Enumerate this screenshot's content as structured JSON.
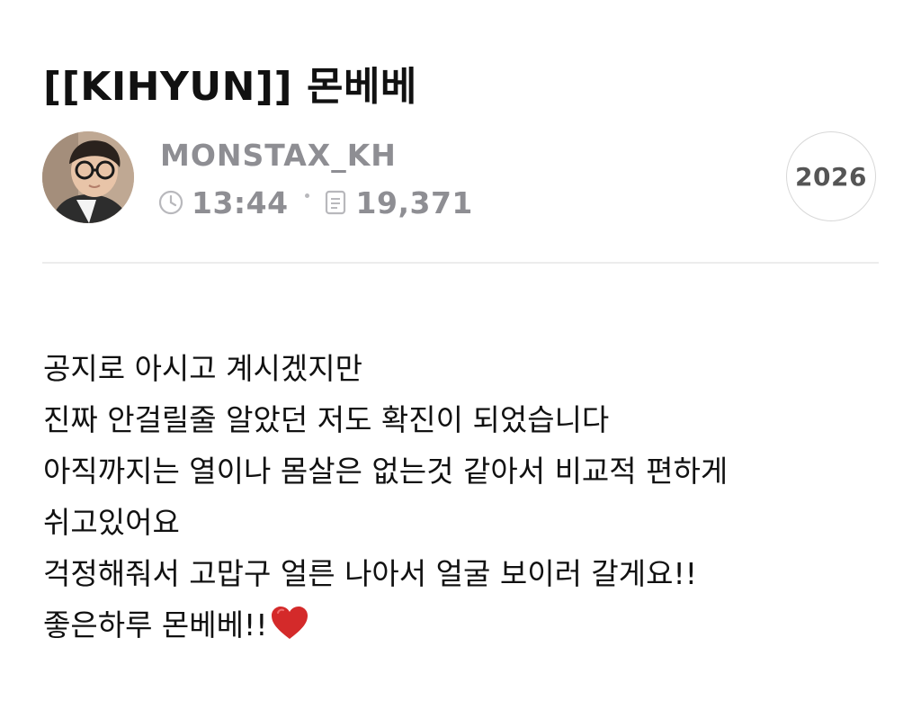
{
  "post": {
    "title": "[[KIHYUN]] 몬베베",
    "author": "MONSTAX_KH",
    "time": "13:44",
    "views": "19,371",
    "count": "2026",
    "lines": [
      "공지로 아시고 계시겠지만",
      "진짜 안걸릴줄 알았던 저도 확진이 되었습니다",
      "아직까지는 열이나 몸살은 없는것 같아서 비교적 편하게",
      "쉬고있어요",
      "걱정해줘서 고맙구 얼른 나아서 얼굴 보이러 갈게요!!",
      "좋은하루 몬베베!!"
    ]
  },
  "icons": {
    "time": "clock-icon",
    "views": "document-icon",
    "emoji": "red-heart-icon"
  },
  "colors": {
    "text": "#111111",
    "meta": "#8e8e93",
    "heart": "#d42a2a",
    "divider": "#ececec"
  }
}
